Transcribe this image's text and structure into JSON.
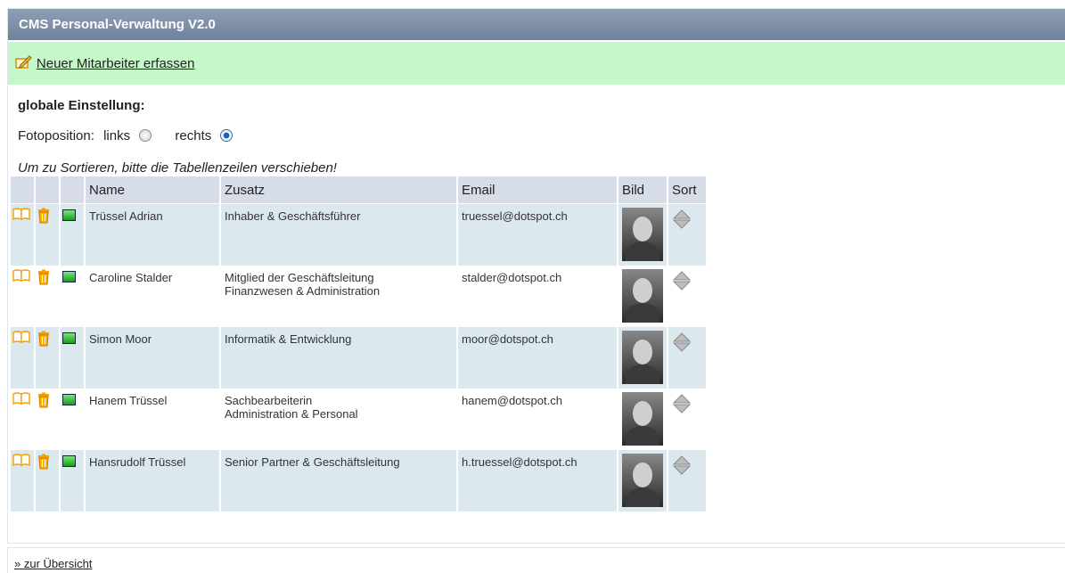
{
  "header": {
    "title": "CMS Personal-Verwaltung V2.0"
  },
  "actions": {
    "new_employee": "Neuer Mitarbeiter erfassen"
  },
  "settings": {
    "heading": "globale Einstellung:",
    "photo_label": "Fotoposition:",
    "option_left": "links",
    "option_right": "rechts",
    "selected": "rechts"
  },
  "hint": "Um zu Sortieren, bitte die Tabellenzeilen verschieben!",
  "table": {
    "headers": {
      "name": "Name",
      "zusatz": "Zusatz",
      "email": "Email",
      "bild": "Bild",
      "sort": "Sort"
    },
    "rows": [
      {
        "name": "Trüssel Adrian",
        "zusatz": [
          "Inhaber & Geschäftsführer"
        ],
        "email": "truessel@dotspot.ch"
      },
      {
        "name": "Caroline Stalder",
        "zusatz": [
          "Mitglied der Geschäftsleitung",
          "Finanzwesen & Administration"
        ],
        "email": "stalder@dotspot.ch"
      },
      {
        "name": "Simon Moor",
        "zusatz": [
          "Informatik & Entwicklung"
        ],
        "email": "moor@dotspot.ch"
      },
      {
        "name": "Hanem Trüssel",
        "zusatz": [
          "Sachbearbeiterin",
          "Administration & Personal"
        ],
        "email": "hanem@dotspot.ch"
      },
      {
        "name": "Hansrudolf Trüssel",
        "zusatz": [
          "Senior Partner & Geschäftsleitung"
        ],
        "email": "h.truessel@dotspot.ch"
      }
    ]
  },
  "footer": {
    "back_link": "» zur Übersicht"
  },
  "colors": {
    "title_bar": "#7f90ab",
    "new_bar": "#c6f7c9",
    "row_alt": "#dbe8ee",
    "header_cell": "#d6dde8",
    "icon_orange": "#f5a000"
  }
}
